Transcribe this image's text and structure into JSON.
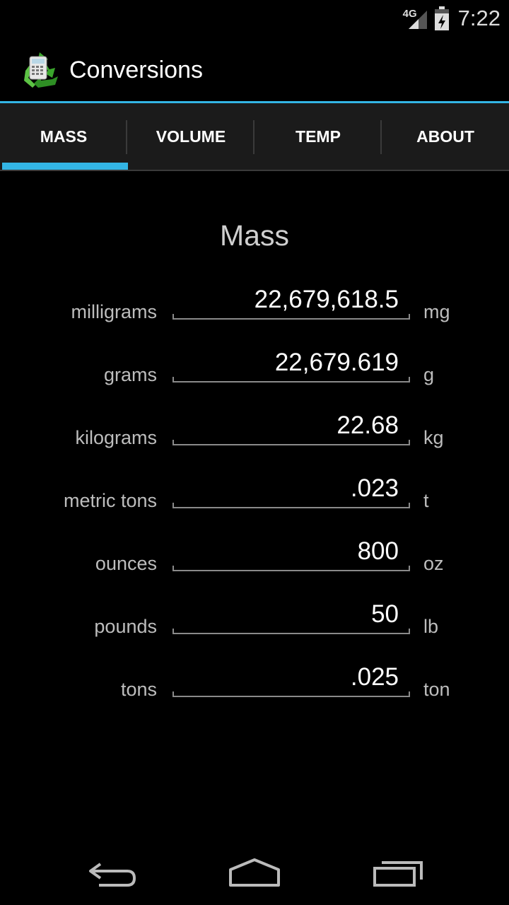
{
  "status_bar": {
    "network": "4G",
    "time": "7:22"
  },
  "action_bar": {
    "title": "Conversions",
    "icon": "recycle-calculator-icon"
  },
  "tabs": [
    {
      "label": "MASS",
      "selected": true
    },
    {
      "label": "VOLUME",
      "selected": false
    },
    {
      "label": "TEMP",
      "selected": false
    },
    {
      "label": "ABOUT",
      "selected": false
    }
  ],
  "section": {
    "title": "Mass"
  },
  "rows": [
    {
      "label": "milligrams",
      "value": "22,679,618.5",
      "unit": "mg"
    },
    {
      "label": "grams",
      "value": "22,679.619",
      "unit": "g"
    },
    {
      "label": "kilograms",
      "value": "22.68",
      "unit": "kg"
    },
    {
      "label": "metric tons",
      "value": ".023",
      "unit": "t"
    },
    {
      "label": "ounces",
      "value": "800",
      "unit": "oz"
    },
    {
      "label": "pounds",
      "value": "50",
      "unit": "lb"
    },
    {
      "label": "tons",
      "value": ".025",
      "unit": "ton"
    }
  ],
  "nav_bar": {
    "buttons": [
      "back-icon",
      "home-icon",
      "recents-icon"
    ]
  },
  "colors": {
    "accent": "#33b5e5",
    "background": "#000000",
    "tab_background": "#1b1b1b"
  }
}
